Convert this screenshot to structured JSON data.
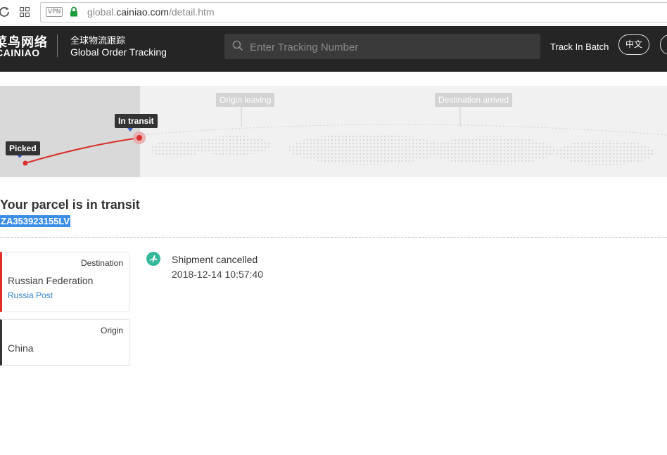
{
  "browser": {
    "vpn_label": "VPN",
    "url_prefix": "global.",
    "url_host": "cainiao.com",
    "url_path": "/detail.htm"
  },
  "header": {
    "logo_cn": "菜鸟网络",
    "logo_en": "CAINIAO",
    "subtitle_cn": "全球物流跟踪",
    "subtitle_en": "Global Order Tracking",
    "search_placeholder": "Enter Tracking Number",
    "batch_label": "Track In Batch",
    "lang_label": "中文"
  },
  "map": {
    "steps": [
      {
        "label": "Picked",
        "state": "done"
      },
      {
        "label": "In transit",
        "state": "current"
      },
      {
        "label": "Origin leaving",
        "state": "pending"
      },
      {
        "label": "Destination arrived",
        "state": "pending"
      }
    ],
    "route_color": "#d9302b"
  },
  "status": {
    "title": "Your parcel is in transit",
    "tracking_number": "ZA353923155LV"
  },
  "destination": {
    "label": "Destination",
    "country": "Russian Federation",
    "carrier": "Russia Post"
  },
  "origin": {
    "label": "Origin",
    "country": "China"
  },
  "events": [
    {
      "icon": "plane-icon",
      "text": "Shipment cancelled",
      "time": "2018-12-14 10:57:40"
    }
  ],
  "colors": {
    "header_bg": "#252525",
    "accent_red": "#e02e24",
    "link_blue": "#2f7fc9",
    "event_icon_green": "#35b99a"
  }
}
